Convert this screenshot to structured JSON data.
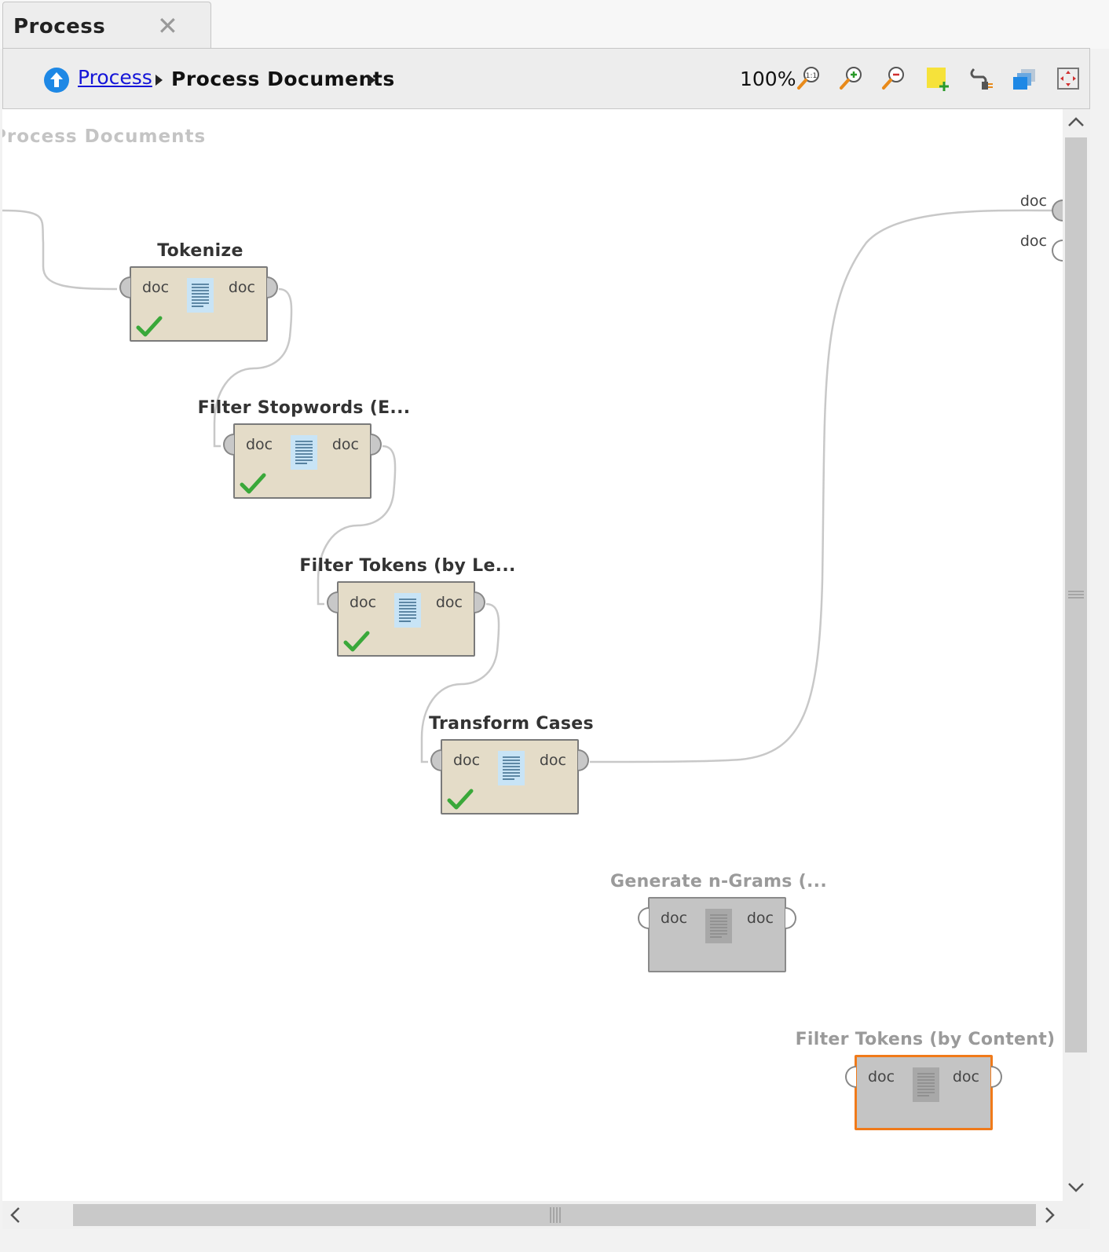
{
  "tab": {
    "title": "Process",
    "close_glyph": "✕"
  },
  "breadcrumb": {
    "root": "Process",
    "current": "Process Documents"
  },
  "toolbar": {
    "zoom": "100%",
    "icons": [
      "zoom-reset-icon",
      "zoom-in-icon",
      "zoom-out-icon",
      "add-note-icon",
      "auto-wire-icon",
      "layers-icon",
      "fit-view-icon"
    ]
  },
  "canvas": {
    "title": "Process Documents",
    "process_ports": [
      {
        "label": "doc",
        "connected": true
      },
      {
        "label": "doc",
        "connected": false
      }
    ]
  },
  "operators": [
    {
      "name": "Tokenize",
      "in": "doc",
      "out": "doc",
      "status": "ok",
      "enabled": true,
      "selected": false
    },
    {
      "name": "Filter Stopwords (E...",
      "in": "doc",
      "out": "doc",
      "status": "ok",
      "enabled": true,
      "selected": false
    },
    {
      "name": "Filter Tokens (by Le...",
      "in": "doc",
      "out": "doc",
      "status": "ok",
      "enabled": true,
      "selected": false
    },
    {
      "name": "Transform Cases",
      "in": "doc",
      "out": "doc",
      "status": "ok",
      "enabled": true,
      "selected": false
    },
    {
      "name": "Generate n-Grams (...",
      "in": "doc",
      "out": "doc",
      "status": "none",
      "enabled": false,
      "selected": false
    },
    {
      "name": "Filter Tokens (by Content)",
      "in": "doc",
      "out": "doc",
      "status": "none",
      "enabled": false,
      "selected": true
    }
  ],
  "colors": {
    "operator_bg": "#e4dcc8",
    "disabled_bg": "#c4c4c4",
    "selected_border": "#f07a1a",
    "link": "#1515d8",
    "check": "#3aa83a"
  }
}
